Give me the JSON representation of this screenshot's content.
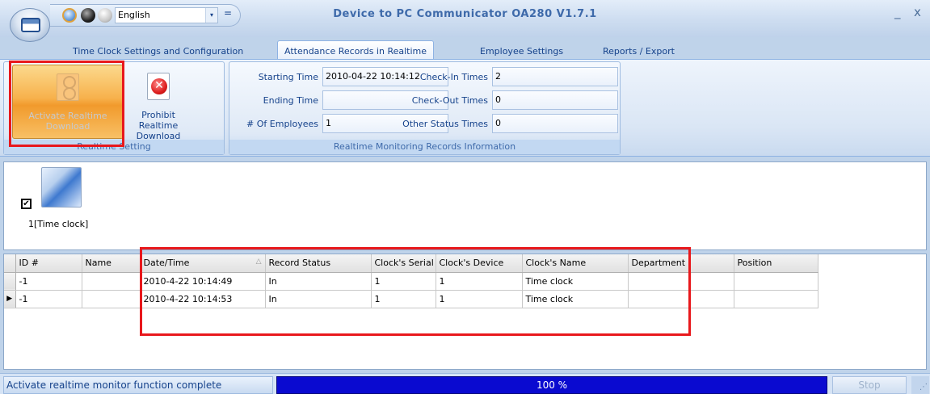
{
  "window": {
    "title": "Device to PC Communicator OA280 V1.7.1",
    "minimize_glyph": "_",
    "close_glyph": "x"
  },
  "quick_access": {
    "language": "English",
    "dropdown_glyph": "▾",
    "more_glyph": "=",
    "icons": [
      "blue-theme-icon",
      "black-theme-icon",
      "silver-theme-icon"
    ]
  },
  "tabs": [
    {
      "label": "Time Clock Settings and Configuration",
      "active": false
    },
    {
      "label": "Attendance Records in Realtime",
      "active": true
    },
    {
      "label": "Employee Settings",
      "active": false
    },
    {
      "label": "Reports / Export",
      "active": false
    }
  ],
  "ribbon": {
    "realtime_setting": {
      "group_label": "Realtime Setting",
      "activate_label": "Activate Realtime Download",
      "prohibit_label": "Prohibit Realtime Download",
      "prohibit_glyph": "✕"
    },
    "monitoring": {
      "group_label": "Realtime Monitoring Records Information",
      "starting_time_label": "Starting Time",
      "starting_time": "2010-04-22 10:14:12",
      "ending_time_label": "Ending Time",
      "ending_time": "",
      "employees_label": "# Of Employees",
      "employees": "1",
      "check_in_label": "Check-In Times",
      "check_in": "2",
      "check_out_label": "Check-Out Times",
      "check_out": "0",
      "other_label": "Other Status Times",
      "other": "0"
    }
  },
  "device": {
    "checked_glyph": "✔",
    "label": "1[Time clock]"
  },
  "grid": {
    "sort_glyph": "△",
    "current_row_glyph": "▶",
    "columns": [
      "ID #",
      "Name",
      "Date/Time",
      "Record Status",
      "Clock's Serial",
      "Clock's Device",
      "Clock's Name",
      "Department",
      "Position"
    ],
    "rows": [
      [
        "-1",
        "",
        "2010-4-22 10:14:49",
        "In",
        "1",
        "1",
        "Time clock",
        "",
        ""
      ],
      [
        "-1",
        "",
        "2010-4-22 10:14:53",
        "In",
        "1",
        "1",
        "Time clock",
        "",
        ""
      ]
    ]
  },
  "status": {
    "message": "Activate realtime monitor function complete",
    "progress_percent": 100,
    "progress_text": "100 %",
    "stop_label": "Stop",
    "grip_glyph": "⋰"
  },
  "colors": {
    "accent": "#15428b",
    "highlight": "#e8181c",
    "progress": "#0a0ad0"
  }
}
